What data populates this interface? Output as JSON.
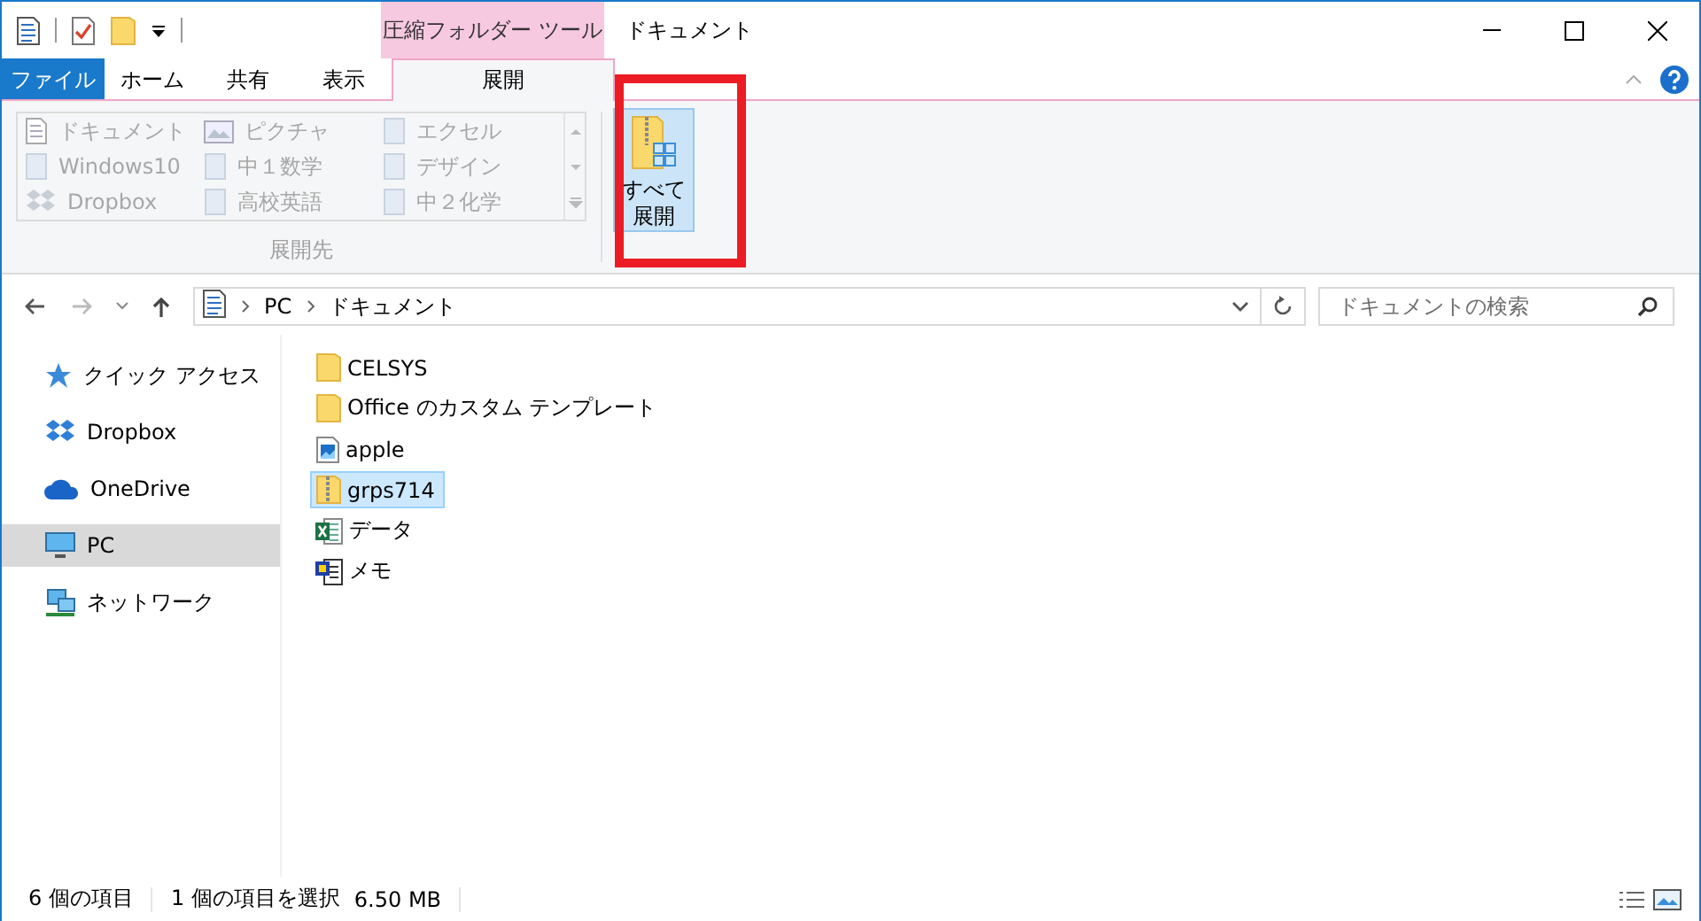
{
  "title_bar": {
    "quick_access": [
      {
        "kind": "properties"
      },
      {
        "kind": "check"
      },
      {
        "kind": "folder"
      },
      {
        "kind": "dropdown"
      }
    ],
    "context_tab_label": "圧縮フォルダー ツール",
    "title": "ドキュメント"
  },
  "tabs": [
    {
      "label": "ファイル",
      "kind": "file",
      "selected": false
    },
    {
      "label": "ホーム",
      "kind": "normal",
      "selected": false
    },
    {
      "label": "共有",
      "kind": "normal",
      "selected": false
    },
    {
      "label": "表示",
      "kind": "normal",
      "selected": false
    },
    {
      "label": "展開",
      "kind": "context",
      "selected": true
    }
  ],
  "ribbon": {
    "destinations": [
      {
        "label": "ドキュメント",
        "kind": "document",
        "disabled": true
      },
      {
        "label": "Windows10",
        "kind": "blank",
        "disabled": true
      },
      {
        "label": "Dropbox",
        "kind": "dropbox",
        "disabled": true
      },
      {
        "label": "ピクチャ",
        "kind": "picture",
        "disabled": true
      },
      {
        "label": "中１数学",
        "kind": "blank",
        "disabled": true
      },
      {
        "label": "高校英語",
        "kind": "blank",
        "disabled": true
      },
      {
        "label": "エクセル",
        "kind": "blank",
        "disabled": true
      },
      {
        "label": "デザイン",
        "kind": "blank",
        "disabled": true
      },
      {
        "label": "中２化学",
        "kind": "blank",
        "disabled": true
      }
    ],
    "group_label": "展開先",
    "extract_all_button": "すべて展開",
    "highlighted": true
  },
  "address_bar": {
    "path": [
      "PC",
      "ドキュメント"
    ]
  },
  "search": {
    "placeholder": "ドキュメントの検索"
  },
  "sidebar": {
    "items": [
      {
        "label": "クイック アクセス",
        "kind": "star",
        "selected": false
      },
      {
        "label": "Dropbox",
        "kind": "dropbox",
        "selected": false
      },
      {
        "label": "OneDrive",
        "kind": "cloud",
        "selected": false
      },
      {
        "label": "PC",
        "kind": "pc",
        "selected": true
      },
      {
        "label": "ネットワーク",
        "kind": "network",
        "selected": false
      }
    ]
  },
  "files": [
    {
      "name": "CELSYS",
      "kind": "folder",
      "selected": false
    },
    {
      "name": "Office のカスタム テンプレート",
      "kind": "folder",
      "selected": false
    },
    {
      "name": "apple",
      "kind": "image",
      "selected": false
    },
    {
      "name": "grps714",
      "kind": "zip",
      "selected": true
    },
    {
      "name": "データ",
      "kind": "excel",
      "selected": false
    },
    {
      "name": "メモ",
      "kind": "text",
      "selected": false
    }
  ],
  "status_bar": {
    "item_count": "6 個の項目",
    "selection": "1 個の項目を選択",
    "size": "6.50 MB"
  }
}
